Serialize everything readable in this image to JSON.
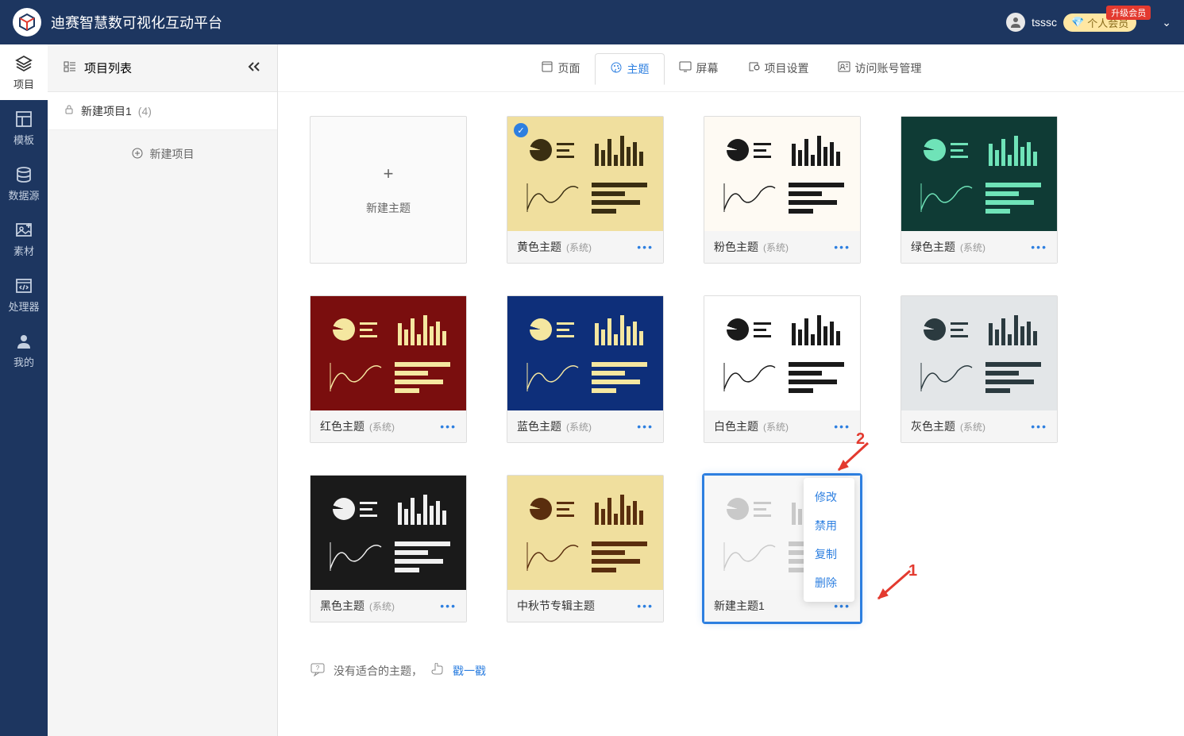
{
  "header": {
    "app_title": "迪赛智慧数可视化互动平台",
    "username": "tsssc",
    "member_label": "个人会员",
    "upgrade_label": "升级会员"
  },
  "left_nav": [
    {
      "label": "项目",
      "icon": "layers-icon",
      "active": true
    },
    {
      "label": "模板",
      "icon": "template-icon",
      "active": false
    },
    {
      "label": "数据源",
      "icon": "database-icon",
      "active": false
    },
    {
      "label": "素材",
      "icon": "image-icon",
      "active": false
    },
    {
      "label": "处理器",
      "icon": "code-icon",
      "active": false
    },
    {
      "label": "我的",
      "icon": "user-icon",
      "active": false
    }
  ],
  "project_panel": {
    "title": "项目列表",
    "project_name": "新建项目1",
    "project_count": "(4)",
    "new_project_label": "新建项目"
  },
  "tabs": [
    {
      "label": "页面",
      "icon": "page-icon",
      "active": false
    },
    {
      "label": "主题",
      "icon": "theme-icon",
      "active": true
    },
    {
      "label": "屏幕",
      "icon": "screen-icon",
      "active": false
    },
    {
      "label": "项目设置",
      "icon": "settings-icon",
      "active": false
    },
    {
      "label": "访问账号管理",
      "icon": "account-icon",
      "active": false
    }
  ],
  "new_theme_label": "新建主题",
  "themes": [
    {
      "name": "黄色主题",
      "sys": "(系统)",
      "bg": "#f0df9e",
      "fg": "#3a2e12",
      "check": true
    },
    {
      "name": "粉色主题",
      "sys": "(系统)",
      "bg": "#fefaf3",
      "fg": "#1a1a1a",
      "check": false
    },
    {
      "name": "绿色主题",
      "sys": "(系统)",
      "bg": "#0f3b35",
      "fg": "#6fe3b8",
      "check": false
    },
    {
      "name": "红色主题",
      "sys": "(系统)",
      "bg": "#7a0e0e",
      "fg": "#f5e7a0",
      "check": false
    },
    {
      "name": "蓝色主题",
      "sys": "(系统)",
      "bg": "#0e2f7a",
      "fg": "#f5e7a0",
      "check": false
    },
    {
      "name": "白色主题",
      "sys": "(系统)",
      "bg": "#ffffff",
      "fg": "#1a1a1a",
      "check": false
    },
    {
      "name": "灰色主题",
      "sys": "(系统)",
      "bg": "#e3e6e8",
      "fg": "#2b3a3f",
      "check": false
    },
    {
      "name": "黑色主题",
      "sys": "(系统)",
      "bg": "#1a1a1a",
      "fg": "#f0f0f0",
      "check": false
    },
    {
      "name": "中秋节专辑主题",
      "sys": "",
      "bg": "#f0df9e",
      "fg": "#5a2e0e",
      "check": false
    },
    {
      "name": "新建主题1",
      "sys": "",
      "bg": "#f7f7f7",
      "fg": "#c9c9c9",
      "check": false,
      "selected": true
    }
  ],
  "context_menu": {
    "items": [
      "修改",
      "禁用",
      "复制",
      "删除"
    ]
  },
  "annotations": {
    "label1": "1",
    "label2": "2"
  },
  "footer": {
    "text": "没有适合的主题，",
    "link": "戳一戳"
  }
}
